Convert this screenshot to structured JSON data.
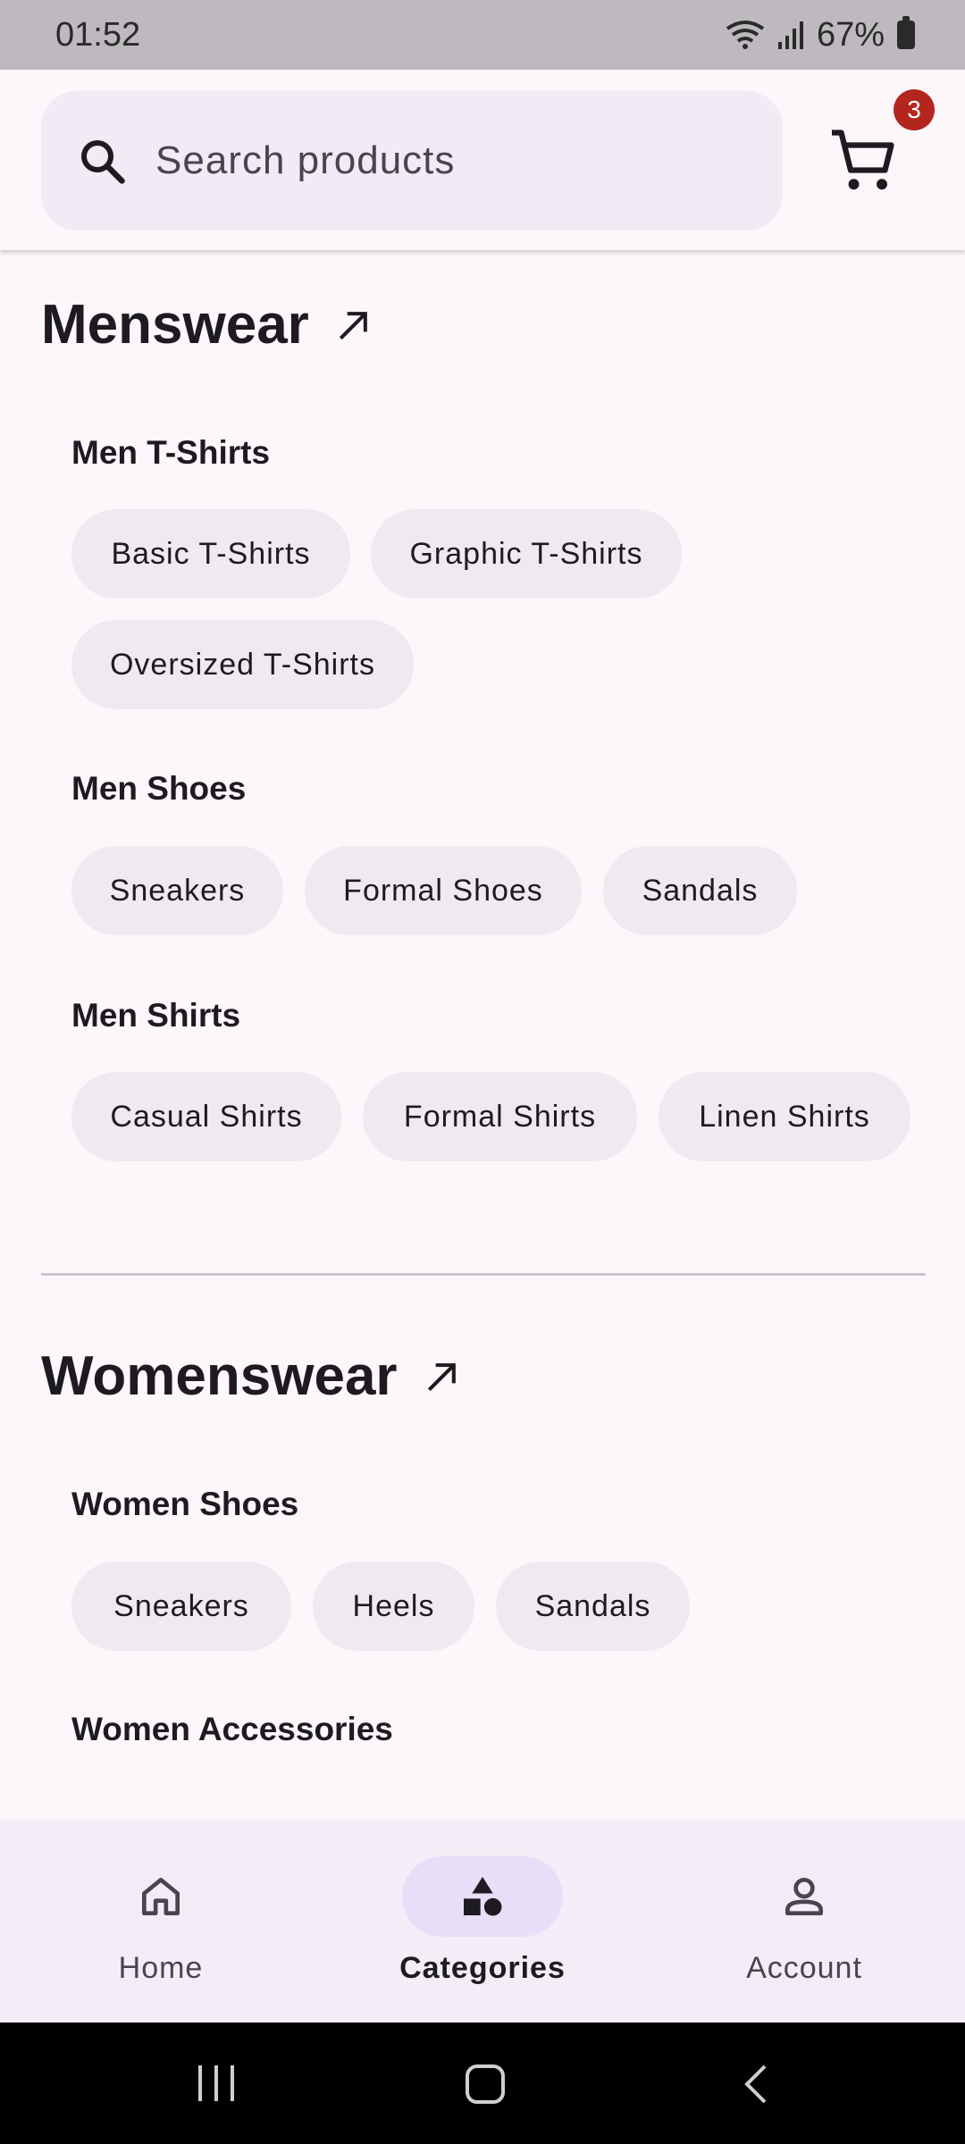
{
  "status_bar": {
    "time": "01:52",
    "battery": "67%"
  },
  "search": {
    "placeholder": "Search products"
  },
  "cart": {
    "badge_count": "3"
  },
  "sections": [
    {
      "title": "Menswear",
      "groups": [
        {
          "title": "Men T-Shirts",
          "chips": [
            "Basic T-Shirts",
            "Graphic T-Shirts",
            "Oversized T-Shirts"
          ]
        },
        {
          "title": "Men Shoes",
          "chips": [
            "Sneakers",
            "Formal Shoes",
            "Sandals"
          ]
        },
        {
          "title": "Men Shirts",
          "chips": [
            "Casual Shirts",
            "Formal Shirts",
            "Linen Shirts"
          ]
        }
      ]
    },
    {
      "title": "Womenswear",
      "groups": [
        {
          "title": "Women Shoes",
          "chips": [
            "Sneakers",
            "Heels",
            "Sandals"
          ]
        },
        {
          "title": "Women Accessories",
          "chips": []
        }
      ]
    }
  ],
  "bottom_nav": {
    "items": [
      {
        "label": "Home",
        "icon": "home-icon",
        "active": false
      },
      {
        "label": "Categories",
        "icon": "categories-icon",
        "active": true
      },
      {
        "label": "Account",
        "icon": "account-icon",
        "active": false
      }
    ]
  },
  "colors": {
    "background": "#fdf7fc",
    "chip": "#efe9f0",
    "badge": "#b3261e",
    "nav_indicator": "#e8def8"
  }
}
